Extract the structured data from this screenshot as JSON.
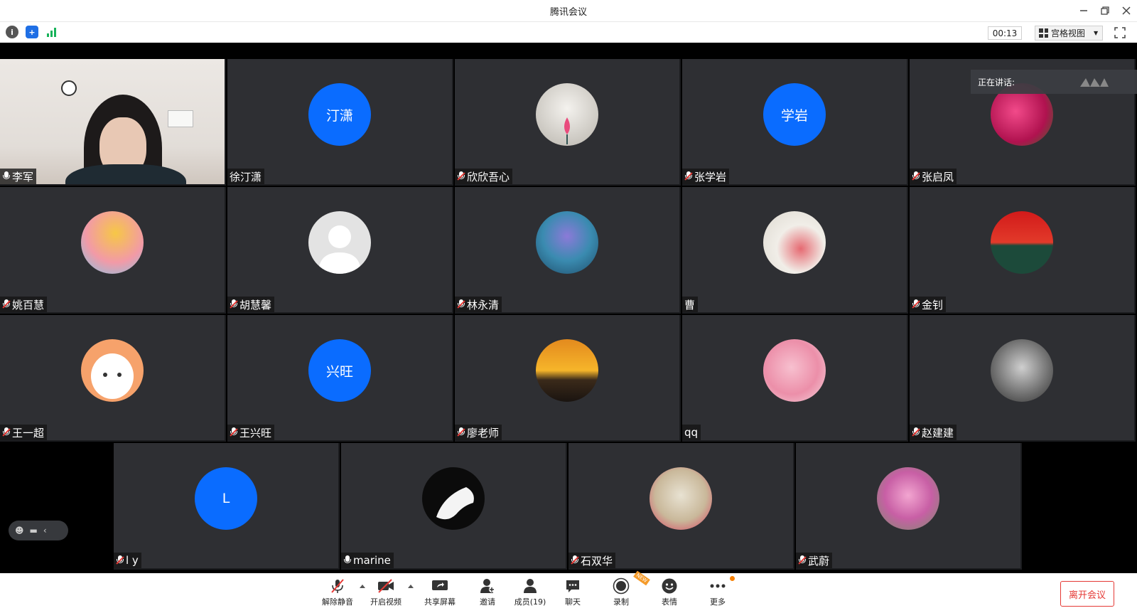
{
  "window": {
    "title": "腾讯会议"
  },
  "infobar": {
    "timer": "00:13",
    "view_mode": "宫格视图"
  },
  "speaking": {
    "label": "正在讲话:"
  },
  "participants": [
    {
      "name": "李军",
      "avatar_text": "",
      "muted": false,
      "camera": true
    },
    {
      "name": "徐汀潇",
      "avatar_text": "汀潇",
      "muted": false,
      "nomic": true
    },
    {
      "name": "欣欣吾心",
      "avatar_text": "",
      "muted": true
    },
    {
      "name": "张学岩",
      "avatar_text": "学岩",
      "muted": true
    },
    {
      "name": "张启凤",
      "avatar_text": "",
      "muted": true
    },
    {
      "name": "姚百慧",
      "avatar_text": "",
      "muted": true
    },
    {
      "name": "胡慧馨",
      "avatar_text": "",
      "muted": true
    },
    {
      "name": "林永清",
      "avatar_text": "",
      "muted": true
    },
    {
      "name": "曹",
      "avatar_text": "",
      "muted": false,
      "nomic": true
    },
    {
      "name": "金钊",
      "avatar_text": "",
      "muted": true
    },
    {
      "name": "王一超",
      "avatar_text": "",
      "muted": true
    },
    {
      "name": "王兴旺",
      "avatar_text": "兴旺",
      "muted": true
    },
    {
      "name": "廖老师",
      "avatar_text": "",
      "muted": true
    },
    {
      "name": "qq",
      "avatar_text": "",
      "muted": false,
      "nomic": true
    },
    {
      "name": "赵建建",
      "avatar_text": "",
      "muted": true
    },
    {
      "name": "l y",
      "avatar_text": "L",
      "muted": true
    },
    {
      "name": "marine",
      "avatar_text": "",
      "muted": false
    },
    {
      "name": "石双华",
      "avatar_text": "",
      "muted": true
    },
    {
      "name": "武蔚",
      "avatar_text": "",
      "muted": true
    }
  ],
  "toolbar": {
    "unmute": "解除静音",
    "start_video": "开启视频",
    "share_screen": "共享屏幕",
    "invite": "邀请",
    "members": "成员(19)",
    "chat": "聊天",
    "record": "录制",
    "reactions": "表情",
    "more": "更多",
    "leave": "离开会议",
    "new_badge": "NEW"
  },
  "colors": {
    "accent_blue": "#0a6cff",
    "leave_red": "#e53935",
    "tile_bg": "#2e2f33"
  }
}
